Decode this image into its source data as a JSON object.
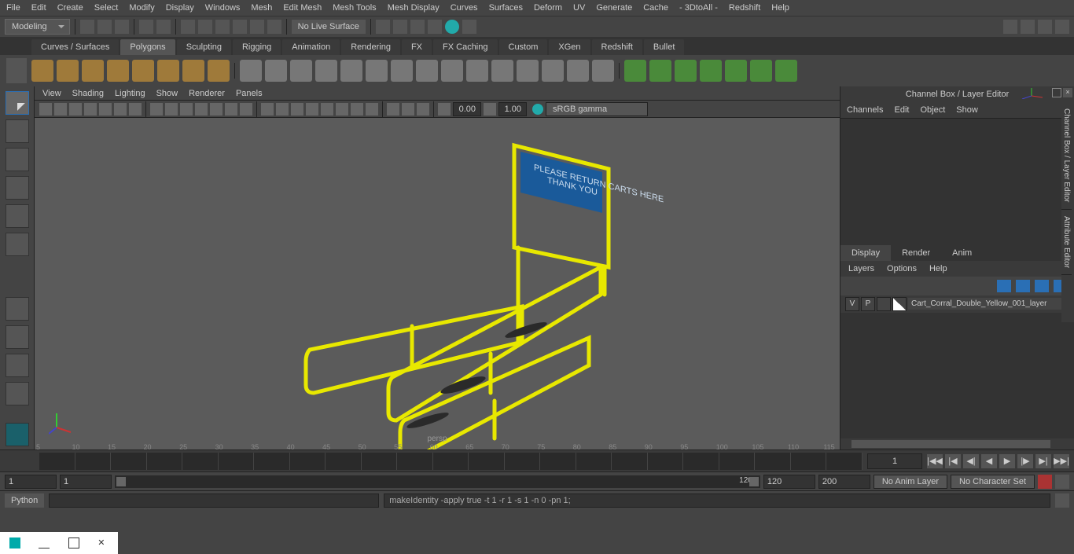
{
  "menu": [
    "File",
    "Edit",
    "Create",
    "Select",
    "Modify",
    "Display",
    "Windows",
    "Mesh",
    "Edit Mesh",
    "Mesh Tools",
    "Mesh Display",
    "Curves",
    "Surfaces",
    "Deform",
    "UV",
    "Generate",
    "Cache",
    "- 3DtoAll -",
    "Redshift",
    "Help"
  ],
  "workspace": "Modeling",
  "no_live": "No Live Surface",
  "shelf_tabs": [
    "Curves / Surfaces",
    "Polygons",
    "Sculpting",
    "Rigging",
    "Animation",
    "Rendering",
    "FX",
    "FX Caching",
    "Custom",
    "XGen",
    "Redshift",
    "Bullet"
  ],
  "shelf_active": 1,
  "vp_menu": [
    "View",
    "Shading",
    "Lighting",
    "Show",
    "Renderer",
    "Panels"
  ],
  "hud_a": "0.00",
  "hud_b": "1.00",
  "colorspace": "sRGB gamma",
  "persp": "persp",
  "sign_line1": "PLEASE RETURN CARTS HERE",
  "sign_line2": "THANK YOU",
  "cb_title": "Channel Box / Layer Editor",
  "cb_menu": [
    "Channels",
    "Edit",
    "Object",
    "Show"
  ],
  "disp_tabs": [
    "Display",
    "Render",
    "Anim"
  ],
  "layer_menu": [
    "Layers",
    "Options",
    "Help"
  ],
  "layer_v": "V",
  "layer_p": "P",
  "layer_name": "Cart_Corral_Double_Yellow_001_layer",
  "side_tabs": [
    "Channel Box / Layer Editor",
    "Attribute Editor"
  ],
  "ticks": [
    "5",
    "10",
    "15",
    "20",
    "25",
    "30",
    "35",
    "40",
    "45",
    "50",
    "55",
    "60",
    "65",
    "70",
    "75",
    "80",
    "85",
    "90",
    "95",
    "100",
    "105",
    "110",
    "115"
  ],
  "cur_frame": "1",
  "range": {
    "a": "1",
    "b": "1",
    "c": "1",
    "d": "120",
    "e": "120",
    "f": "200"
  },
  "anim_layer": "No Anim Layer",
  "char_set": "No Character Set",
  "cmd_lang": "Python",
  "cmd_out": "makeIdentity -apply true -t 1 -r 1 -s 1 -n 0 -pn 1;"
}
